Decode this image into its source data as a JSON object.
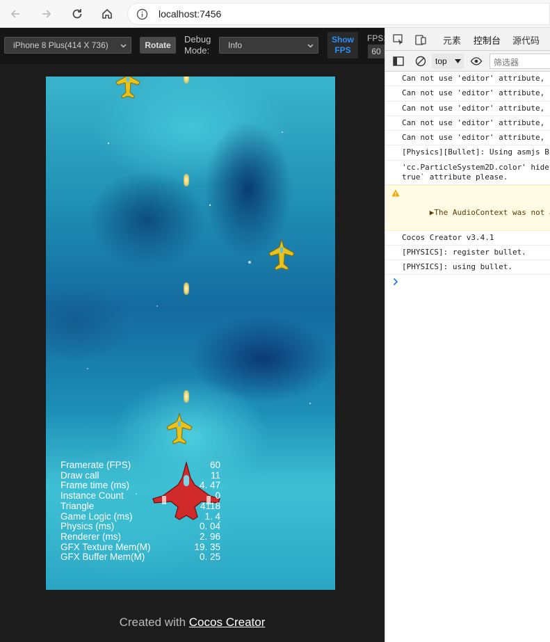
{
  "browser": {
    "url": "localhost:7456"
  },
  "toolbar": {
    "device": "iPhone 8 Plus(414 X 736)",
    "rotate_label": "Rotate",
    "debug_mode_label_line1": "Debug",
    "debug_mode_label_line2": "Mode:",
    "debug_mode_value": "Info",
    "show_fps_line1": "Show",
    "show_fps_line2": "FPS",
    "fps_label": "FPS:",
    "fps_value": "60"
  },
  "stats": [
    {
      "label": "Framerate (FPS)",
      "value": "60"
    },
    {
      "label": "Draw call",
      "value": "11"
    },
    {
      "label": "Frame time (ms)",
      "value": "4. 47"
    },
    {
      "label": "Instance Count",
      "value": "0"
    },
    {
      "label": "Triangle",
      "value": "4118"
    },
    {
      "label": "Game Logic (ms)",
      "value": "1. 4"
    },
    {
      "label": "Physics (ms)",
      "value": "0. 04"
    },
    {
      "label": "Renderer (ms)",
      "value": "2. 96"
    },
    {
      "label": "GFX Texture Mem(M)",
      "value": "19. 35"
    },
    {
      "label": "GFX Buffer Mem(M)",
      "value": "0. 25"
    }
  ],
  "footer": {
    "prefix": "Created with ",
    "link": "Cocos Creator"
  },
  "devtools": {
    "tabs": [
      "元素",
      "控制台",
      "源代码"
    ],
    "active_tab": "控制台",
    "context": "top",
    "filter_placeholder": "筛选器",
    "logs": [
      {
        "level": "info",
        "text": "Can not use 'editor' attribute,"
      },
      {
        "level": "info",
        "text": "Can not use 'editor' attribute,"
      },
      {
        "level": "info",
        "text": "Can not use 'editor' attribute,"
      },
      {
        "level": "info",
        "text": "Can not use 'editor' attribute,"
      },
      {
        "level": "info",
        "text": "Can not use 'editor' attribute,"
      },
      {
        "level": "info",
        "text": "[Physics][Bullet]: Using asmjs Bu"
      },
      {
        "level": "info",
        "text": "'cc.ParticleSystem2D.color' hide\ntrue` attribute please."
      },
      {
        "level": "warn",
        "text": "▶The AudioContext was not allow"
      },
      {
        "level": "info",
        "text": "Cocos Creator v3.4.1"
      },
      {
        "level": "info",
        "text": "[PHYSICS]: register bullet."
      },
      {
        "level": "info",
        "text": "[PHYSICS]: using bullet."
      }
    ]
  },
  "colors": {
    "accent_blue": "#1a73e8",
    "fps_button": "#2a8ff7",
    "enemy_plane": "#e8c21e",
    "player_plane": "#d12a2a"
  }
}
